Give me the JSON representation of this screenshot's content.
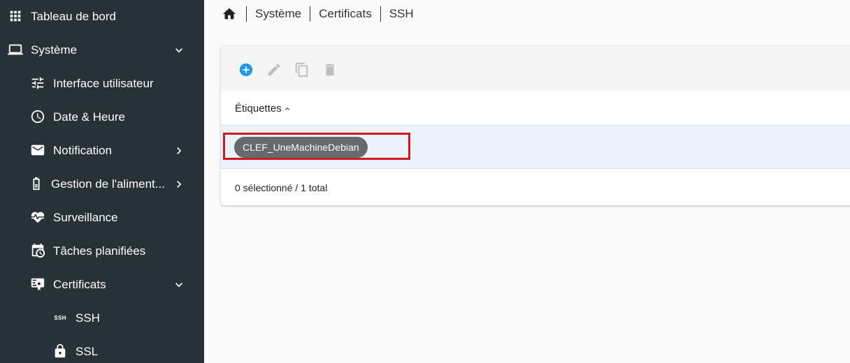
{
  "sidebar": {
    "items": [
      {
        "label": "Tableau de bord",
        "icon": "grid-icon"
      },
      {
        "label": "Système",
        "icon": "laptop-icon",
        "chevron": "down"
      },
      {
        "label": "Interface utilisateur",
        "icon": "tune-icon"
      },
      {
        "label": "Date & Heure",
        "icon": "clock-icon"
      },
      {
        "label": "Notification",
        "icon": "mail-icon",
        "chevron": "right"
      },
      {
        "label": "Gestion de l'aliment...",
        "icon": "battery-icon",
        "chevron": "right"
      },
      {
        "label": "Surveillance",
        "icon": "heart-pulse-icon"
      },
      {
        "label": "Tâches planifiées",
        "icon": "calendar-clock-icon"
      },
      {
        "label": "Certificats",
        "icon": "certificate-icon",
        "chevron": "down"
      },
      {
        "label": "SSH",
        "icon": "ssh-icon",
        "icon_text": "SSH"
      },
      {
        "label": "SSL",
        "icon": "lock-icon"
      }
    ]
  },
  "breadcrumb": {
    "items": [
      "Système",
      "Certificats",
      "SSH"
    ]
  },
  "table": {
    "column_header": "Étiquettes",
    "rows": [
      {
        "label": "CLEF_UneMachineDebian"
      }
    ],
    "status": "0 sélectionné / 1 total"
  },
  "colors": {
    "sidebar_bg": "#263238",
    "add_button": "#2196f3",
    "highlight": "#d01820",
    "selected_row": "#ebf2fb"
  }
}
